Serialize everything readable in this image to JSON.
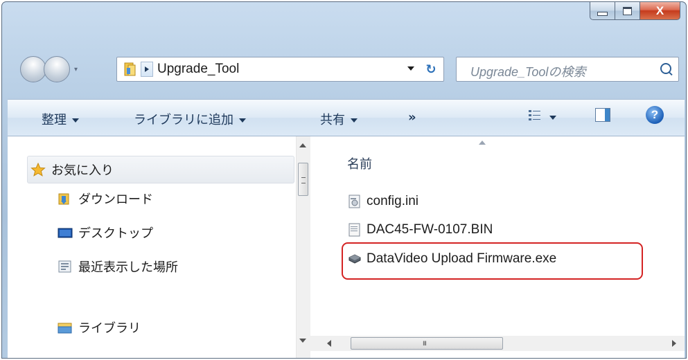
{
  "window": {
    "caption_buttons": {
      "close_glyph": "X"
    }
  },
  "address_bar": {
    "path": "Upgrade_Tool",
    "search_placeholder": "Upgrade_Toolの検索"
  },
  "toolbar": {
    "organize_label": "整理",
    "add_to_library_label": "ライブラリに追加",
    "share_label": "共有",
    "more_label": "»"
  },
  "navigation_pane": {
    "items": [
      {
        "label": "お気に入り",
        "icon": "star-icon"
      },
      {
        "label": "ダウンロード",
        "icon": "downloads-folder-icon"
      },
      {
        "label": "デスクトップ",
        "icon": "desktop-icon"
      },
      {
        "label": "最近表示した場所",
        "icon": "recent-places-icon"
      },
      {
        "label": "ライブラリ",
        "icon": "library-icon"
      }
    ]
  },
  "file_list": {
    "column_header": "名前",
    "files": [
      {
        "name": "config.ini",
        "icon": "ini-file-icon"
      },
      {
        "name": "DAC45-FW-0107.BIN",
        "icon": "bin-file-icon"
      },
      {
        "name": "DataVideo Upload Firmware.exe",
        "icon": "exe-file-icon",
        "highlighted": true
      }
    ]
  },
  "scrollbar": {
    "grip": "III"
  },
  "colors": {
    "highlight_border": "#d42323",
    "toolbar_text": "#1e395b",
    "close_button": "#c53a1c"
  }
}
